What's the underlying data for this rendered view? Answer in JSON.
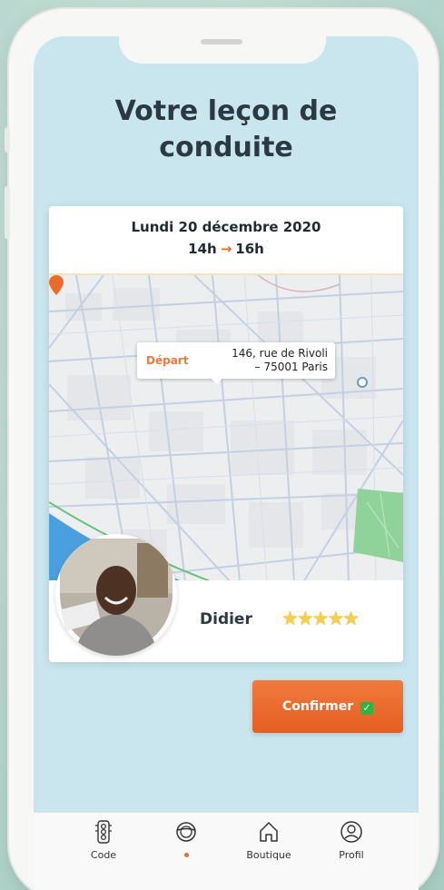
{
  "page": {
    "title": "Votre leçon de\nconduite"
  },
  "lesson": {
    "date": "Lundi 20 décembre 2020",
    "time_start": "14h",
    "time_arrow": "→",
    "time_end": "16h"
  },
  "map": {
    "marker_label": "Départ",
    "address_line1": "146, rue de Rivoli",
    "address_line2": "– 75001 Paris"
  },
  "driver": {
    "name": "Didier",
    "stars": "★★★★★",
    "rating": 5
  },
  "actions": {
    "confirm_label": "Confirmer",
    "confirm_emoji": "✓"
  },
  "tabbar": {
    "items": [
      {
        "label": "Code",
        "icon": "traffic-light-icon"
      },
      {
        "label": "",
        "icon": "steering-wheel-icon",
        "active": true
      },
      {
        "label": "Boutique",
        "icon": "home-icon"
      },
      {
        "label": "Profil",
        "icon": "profile-icon"
      }
    ]
  },
  "colors": {
    "accent": "#f06a25",
    "screen_bg": "#c9e6ee",
    "title": "#2b3a42",
    "star": "#f7cf46"
  }
}
